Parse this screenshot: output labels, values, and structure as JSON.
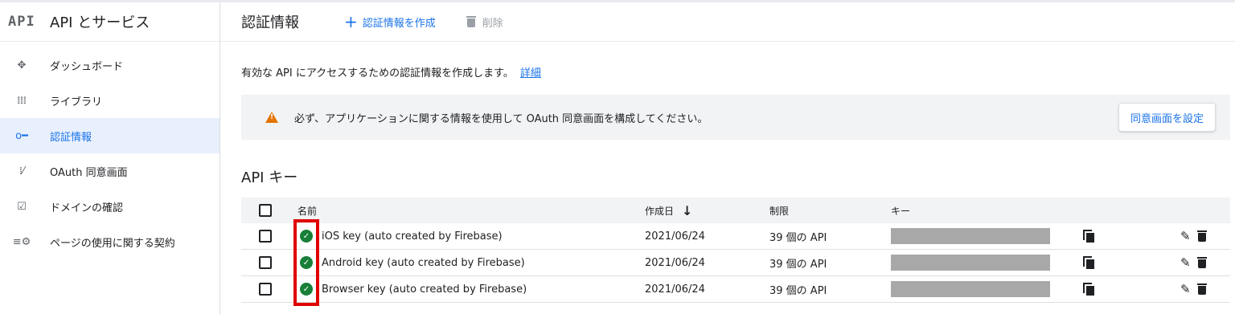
{
  "sidebar": {
    "logo": "API",
    "title": "API とサービス",
    "items": [
      {
        "label": "ダッシュボード",
        "icon": "dashboard-icon",
        "glyph": "✥"
      },
      {
        "label": "ライブラリ",
        "icon": "library-icon",
        "glyph": "𝍖"
      },
      {
        "label": "認証情報",
        "icon": "key-icon",
        "glyph": "o━"
      },
      {
        "label": "OAuth 同意画面",
        "icon": "consent-icon",
        "glyph": "⁞⁄"
      },
      {
        "label": "ドメインの確認",
        "icon": "domain-check-icon",
        "glyph": "☑"
      },
      {
        "label": "ページの使用に関する契約",
        "icon": "settings-list-icon",
        "glyph": "≡⚙"
      }
    ],
    "active_index": 2
  },
  "header": {
    "title": "認証情報",
    "create_label": "認証情報を作成",
    "delete_label": "削除"
  },
  "main": {
    "intro_text": "有効な API にアクセスするための認証情報を作成します。",
    "intro_link": "詳細",
    "banner_text": "必ず、アプリケーションに関する情報を使用して OAuth 同意画面を構成してください。",
    "banner_button": "同意画面を設定",
    "section_title": "API キー",
    "table": {
      "headers": {
        "name": "名前",
        "created": "作成日",
        "sort_glyph": "↓",
        "restriction": "制限",
        "key": "キー"
      },
      "rows": [
        {
          "name": "iOS key (auto created by Firebase)",
          "created": "2021/06/24",
          "restriction": "39 個の API"
        },
        {
          "name": "Android key (auto created by Firebase)",
          "created": "2021/06/24",
          "restriction": "39 個の API"
        },
        {
          "name": "Browser key (auto created by Firebase)",
          "created": "2021/06/24",
          "restriction": "39 個の API"
        }
      ]
    }
  },
  "colors": {
    "accent": "#1a73e8",
    "warning": "#e37400",
    "success": "#188038",
    "highlight": "#e00000"
  }
}
